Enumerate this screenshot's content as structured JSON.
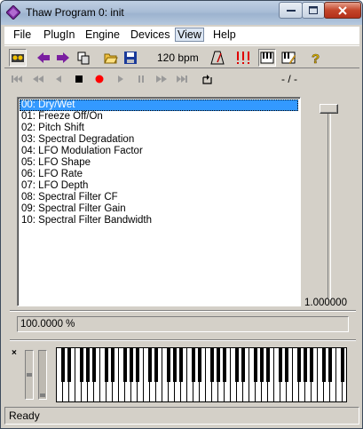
{
  "window": {
    "title": "Thaw Program 0: init"
  },
  "menu": {
    "items": [
      "File",
      "PlugIn",
      "Engine",
      "Devices",
      "View",
      "Help"
    ],
    "active": "View"
  },
  "toolbar": {
    "bpm": "120 bpm",
    "position": "- / -"
  },
  "params": {
    "items": [
      "00: Dry/Wet",
      "01: Freeze Off/On",
      "02: Pitch Shift",
      "03: Spectral Degradation",
      "04: LFO Modulation Factor",
      "05: LFO Shape",
      "06: LFO Rate",
      "07: LFO Depth",
      "08: Spectral Filter CF",
      "09: Spectral Filter Gain",
      "10: Spectral Filter Bandwidth"
    ],
    "selected_index": 0
  },
  "slider": {
    "value_label": "1.000000",
    "value": 1.0
  },
  "value_field": {
    "text": "100.0000 %"
  },
  "keyboard": {
    "close_label": "×"
  },
  "status": {
    "text": "Ready"
  },
  "colors": {
    "selection": "#3399ff",
    "chrome": "#d4d0c8",
    "transport_record": "#ff0000",
    "nav_arrows": "#7a1fa0"
  }
}
